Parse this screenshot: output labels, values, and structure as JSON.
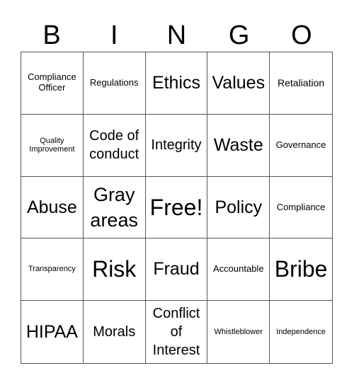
{
  "header": [
    "B",
    "I",
    "N",
    "G",
    "O"
  ],
  "cells": [
    {
      "text": "Compliance Officer",
      "size": "s2"
    },
    {
      "text": "Regulations",
      "size": "s2"
    },
    {
      "text": "Ethics",
      "size": "s5"
    },
    {
      "text": "Values",
      "size": "s5"
    },
    {
      "text": "Retaliation",
      "size": "s3"
    },
    {
      "text": "Quality Improvement",
      "size": "s1"
    },
    {
      "text": "Code of conduct",
      "size": "s4"
    },
    {
      "text": "Integrity",
      "size": "s4"
    },
    {
      "text": "Waste",
      "size": "s5"
    },
    {
      "text": "Governance",
      "size": "s2"
    },
    {
      "text": "Abuse",
      "size": "s5"
    },
    {
      "text": "Gray areas",
      "size": "s6"
    },
    {
      "text": "Free!",
      "size": "s7"
    },
    {
      "text": "Policy",
      "size": "s5"
    },
    {
      "text": "Compliance",
      "size": "s2"
    },
    {
      "text": "Transparency",
      "size": "s1"
    },
    {
      "text": "Risk",
      "size": "s7"
    },
    {
      "text": "Fraud",
      "size": "s5"
    },
    {
      "text": "Accountable",
      "size": "s2"
    },
    {
      "text": "Bribe",
      "size": "s7"
    },
    {
      "text": "HIPAA",
      "size": "s5"
    },
    {
      "text": "Morals",
      "size": "s4"
    },
    {
      "text": "Conflict of Interest",
      "size": "s4"
    },
    {
      "text": "Whistleblower",
      "size": "s1"
    },
    {
      "text": "Independence",
      "size": "s1"
    }
  ]
}
